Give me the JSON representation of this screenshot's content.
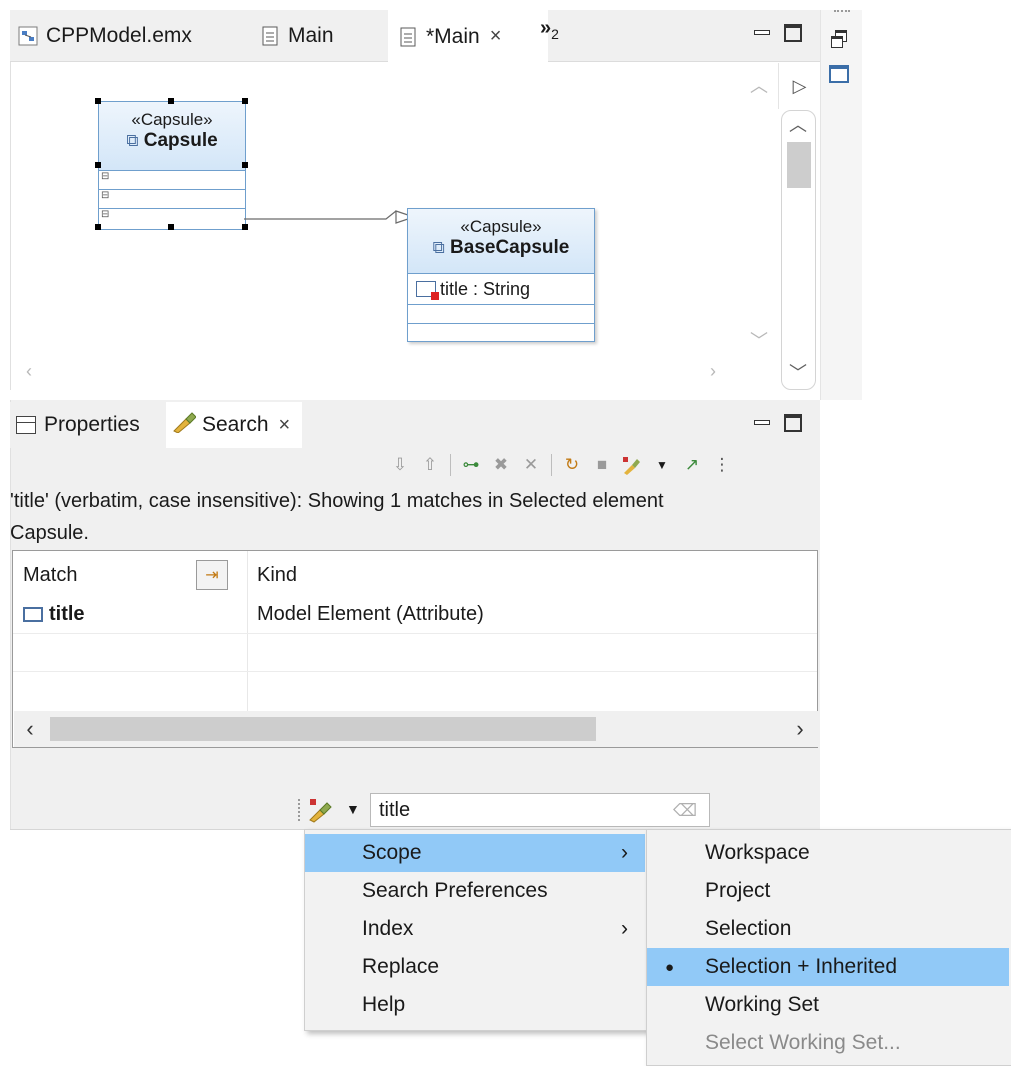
{
  "editor": {
    "tabs": [
      {
        "label": "CPPModel.emx",
        "icon": "model-icon"
      },
      {
        "label": "Main",
        "icon": "diagram-icon"
      },
      {
        "label": "*Main",
        "icon": "diagram-icon",
        "active": true
      }
    ],
    "overflow_label": "»",
    "overflow_count": "2",
    "close_glyph": "×"
  },
  "diagram": {
    "capsule": {
      "stereotype": "«Capsule»",
      "name": "Capsule"
    },
    "base_capsule": {
      "stereotype": "«Capsule»",
      "name": "BaseCapsule",
      "attribute": "title : String"
    }
  },
  "search_view": {
    "tabs": [
      {
        "label": "Properties",
        "icon": "properties-icon"
      },
      {
        "label": "Search",
        "icon": "search-flashlight-icon",
        "active": true
      }
    ],
    "close_glyph": "×",
    "status_line1": "'title' (verbatim, case insensitive): Showing 1 matches in Selected element",
    "status_line2": "Capsule.",
    "columns": {
      "match": "Match",
      "kind": "Kind"
    },
    "rows": [
      {
        "match": "title",
        "kind": "Model Element (Attribute)"
      }
    ]
  },
  "quick_search": {
    "value": "title"
  },
  "menu": {
    "items": [
      {
        "label": "Scope",
        "submenu": true,
        "highlighted": true
      },
      {
        "label": "Search Preferences",
        "submenu": false
      },
      {
        "label": "Index",
        "submenu": true
      },
      {
        "label": "Replace",
        "submenu": false
      },
      {
        "label": "Help",
        "submenu": false
      }
    ],
    "submenu_arrow": "›"
  },
  "scope_submenu": {
    "items": [
      {
        "label": "Workspace"
      },
      {
        "label": "Project"
      },
      {
        "label": "Selection"
      },
      {
        "label": "Selection + Inherited",
        "selected": true,
        "highlighted": true
      },
      {
        "label": "Working Set"
      },
      {
        "label": "Select Working Set...",
        "disabled": true
      }
    ],
    "bullet": "●"
  },
  "colors": {
    "accent_highlight": "#91c9f7",
    "uml_border": "#6f9fcd"
  }
}
